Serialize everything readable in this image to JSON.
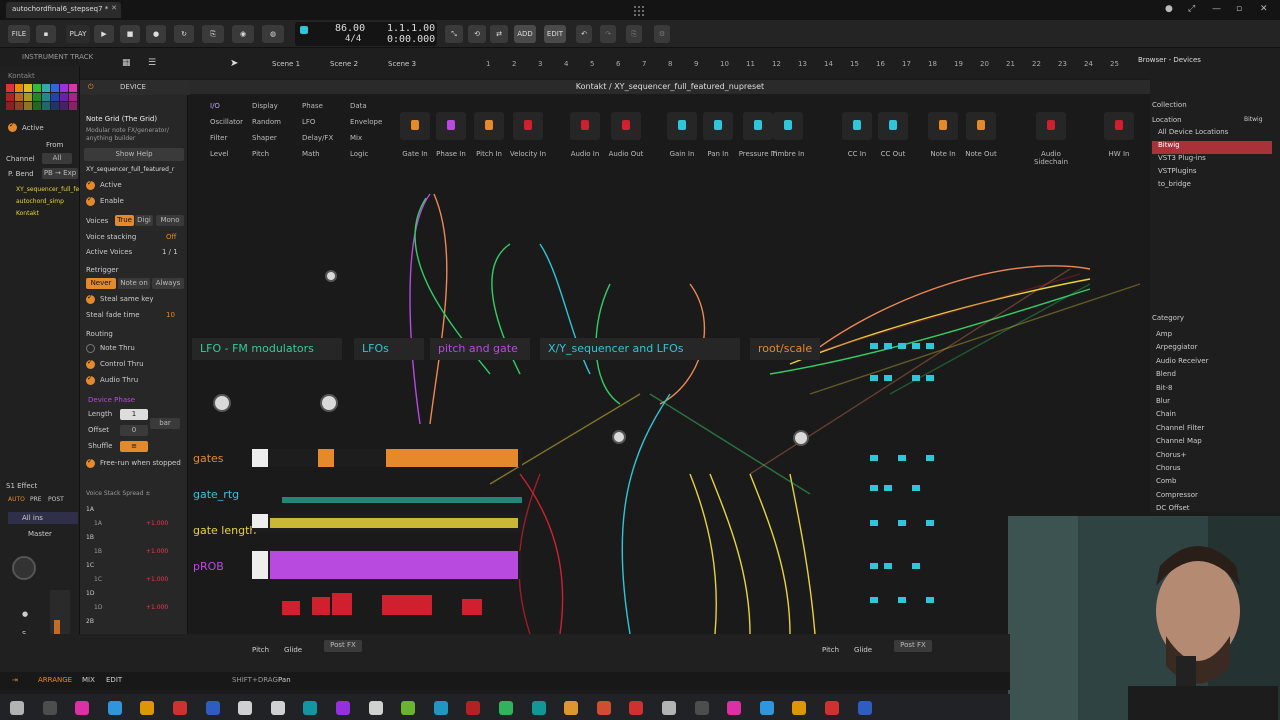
{
  "window": {
    "tab_title": "autochordfinal6_stepseq7 *",
    "tab_close": "✕"
  },
  "transport": {
    "file": "FILE",
    "play_label": "PLAY",
    "add": "ADD",
    "edit": "EDIT",
    "tempo": "86.00",
    "time_sig": "4/4",
    "position": "1.1.1.00",
    "time": "0:00.000"
  },
  "track": {
    "label": "INSTRUMENT TRACK",
    "name": "Kontakt",
    "active": "Active",
    "from": "From",
    "channel": "Channel",
    "all": "All",
    "pbend": "P. Bend",
    "pbexp": "PB → Exp",
    "items": [
      "XY_sequencer_full_fe",
      "autochord_simp",
      "Kontakt"
    ]
  },
  "scenes": [
    "Scene 1",
    "Scene 2",
    "Scene 3"
  ],
  "ruler": [
    "1",
    "2",
    "3",
    "4",
    "5",
    "6",
    "7",
    "8",
    "9",
    "10",
    "11",
    "12",
    "13",
    "14",
    "15",
    "16",
    "17",
    "18",
    "19",
    "20",
    "21",
    "22",
    "23",
    "24",
    "25"
  ],
  "device": {
    "header": "DEVICE",
    "name": "Note Grid (The Grid)",
    "desc": "Modular note FX/generator/ anything builder",
    "show_help": "Show Help",
    "preset": "XY_sequencer_full_featured_r",
    "active": "Active",
    "enable": "Enable",
    "voices": "Voices",
    "voices_true": "True",
    "voices_digi": "Digi",
    "voices_mono": "Mono",
    "voice_stacking": "Voice stacking",
    "voice_stacking_val": "Off",
    "active_voices": "Active Voices",
    "active_voices_val": "1 / 1",
    "retrigger": "Retrigger",
    "never": "Never",
    "note_on": "Note on",
    "always": "Always",
    "steal_same": "Steal same key",
    "steal_fade": "Steal fade time",
    "steal_fade_val": "10",
    "routing": "Routing",
    "note_thru": "Note Thru",
    "control_thru": "Control Thru",
    "audio_thru": "Audio Thru",
    "device_phase": "Device Phase",
    "length": "Length",
    "offset": "Offset",
    "shuffle": "Shuffle",
    "free_run": "Free-run when stopped",
    "bar": "bar",
    "vss": "Voice Stack Spread ±",
    "vs_rows": [
      "1A",
      "1A",
      "1B",
      "1B",
      "1C",
      "1C",
      "1D",
      "1D",
      "2B"
    ],
    "vs_vals": [
      "+1.000",
      "+1.000",
      "+1.000",
      "+1.000"
    ]
  },
  "main": {
    "title": "Kontakt / XY_sequencer_full_featured_nupreset",
    "cat_tabs": [
      "I/O",
      "Display",
      "Phase",
      "Data",
      "Oscillator",
      "Random",
      "LFO",
      "Envelope",
      "Filter",
      "Shaper",
      "Delay/FX",
      "Mix",
      "Level",
      "Pitch",
      "Math",
      "Logic"
    ],
    "io_blocks": [
      "Gate In",
      "Phase In",
      "Pitch In",
      "Velocity In",
      "Audio In",
      "Audio Out",
      "Gain In",
      "Pan In",
      "Pressure In",
      "Timbre In",
      "CC In",
      "CC Out",
      "Note In",
      "Note Out",
      "Audio Sidechain",
      "HW In"
    ],
    "modules": [
      "LFO - FM modulators",
      "LFOs",
      "pitch and gate",
      "X/Y_sequencer and LFOs",
      "root/scale"
    ],
    "rows": [
      "gates",
      "gate_rtg",
      "gate length",
      "pROB"
    ]
  },
  "bottom": {
    "pitch": "Pitch",
    "glide": "Glide",
    "post_fx": "Post FX",
    "effect": "S1 Effect",
    "auto": "AUTO",
    "pre": "PRE",
    "post": "POST",
    "all_ins": "All ins",
    "master": "Master"
  },
  "status": {
    "arrange": "ARRANGE",
    "mix": "MIX",
    "edit": "EDIT",
    "hint": "SHIFT+DRAG",
    "pan": "Pan"
  },
  "browser": {
    "title": "Browser - Devices",
    "collection": "Collection",
    "location": "Location",
    "loc_tag": "Bitwig",
    "locations": [
      "All Device Locations",
      "Bitwig",
      "VST3 Plug-ins",
      "VSTPlugins",
      "to_bridge"
    ],
    "category": "Category",
    "categories": [
      "Amp",
      "Arpeggiator",
      "Audio Receiver",
      "Blend",
      "Bit-8",
      "Blur",
      "Chain",
      "Channel Filter",
      "Channel Map",
      "Chorus+",
      "Chorus",
      "Comb",
      "Compressor",
      "DC Offset"
    ]
  },
  "colors": {
    "accent": "#e58a2a",
    "cyan": "#2ec6d8",
    "yellow": "#e8d23a",
    "purple": "#b84adf",
    "red": "#d02030",
    "green": "#2bbf8a"
  }
}
